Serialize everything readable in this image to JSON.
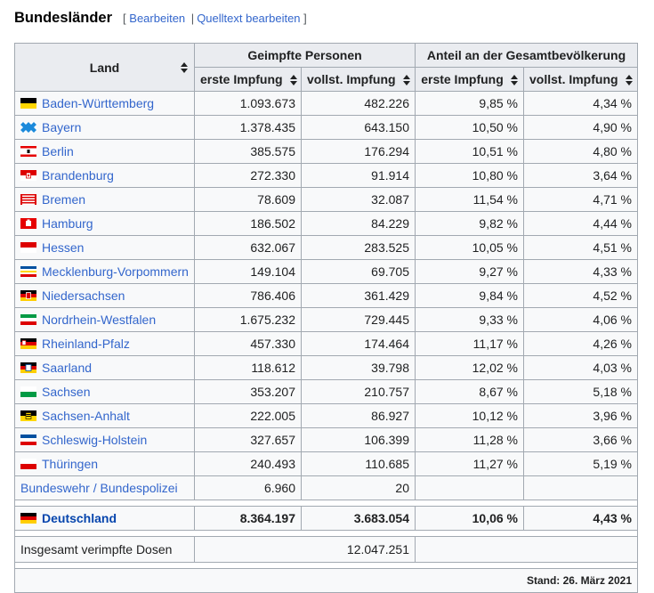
{
  "section": {
    "title": "Bundesländer",
    "bracket_open": "[",
    "edit": "Bearbeiten",
    "separator": "|",
    "edit_source": "Quelltext bearbeiten",
    "bracket_close": "]"
  },
  "table": {
    "header_land": "Land",
    "header_group1": "Geimpfte Personen",
    "header_group2": "Anteil an der Gesamtbevölkerung",
    "sub_erste": "erste Impfung",
    "sub_vollst": "vollst. Impfung",
    "rows": [
      {
        "name": "Baden-Württemberg",
        "flag": "bw",
        "erste": "1.093.673",
        "vollst": "482.226",
        "p_erste": "9,85 %",
        "p_vollst": "4,34 %"
      },
      {
        "name": "Bayern",
        "flag": "by",
        "erste": "1.378.435",
        "vollst": "643.150",
        "p_erste": "10,50 %",
        "p_vollst": "4,90 %"
      },
      {
        "name": "Berlin",
        "flag": "be",
        "erste": "385.575",
        "vollst": "176.294",
        "p_erste": "10,51 %",
        "p_vollst": "4,80 %"
      },
      {
        "name": "Brandenburg",
        "flag": "bb",
        "erste": "272.330",
        "vollst": "91.914",
        "p_erste": "10,80 %",
        "p_vollst": "3,64 %"
      },
      {
        "name": "Bremen",
        "flag": "hb",
        "erste": "78.609",
        "vollst": "32.087",
        "p_erste": "11,54 %",
        "p_vollst": "4,71 %"
      },
      {
        "name": "Hamburg",
        "flag": "hh",
        "erste": "186.502",
        "vollst": "84.229",
        "p_erste": "9,82 %",
        "p_vollst": "4,44 %"
      },
      {
        "name": "Hessen",
        "flag": "he",
        "erste": "632.067",
        "vollst": "283.525",
        "p_erste": "10,05 %",
        "p_vollst": "4,51 %"
      },
      {
        "name": "Mecklenburg-Vorpommern",
        "flag": "mv",
        "erste": "149.104",
        "vollst": "69.705",
        "p_erste": "9,27 %",
        "p_vollst": "4,33 %"
      },
      {
        "name": "Niedersachsen",
        "flag": "ni",
        "erste": "786.406",
        "vollst": "361.429",
        "p_erste": "9,84 %",
        "p_vollst": "4,52 %"
      },
      {
        "name": "Nordrhein-Westfalen",
        "flag": "nw",
        "erste": "1.675.232",
        "vollst": "729.445",
        "p_erste": "9,33 %",
        "p_vollst": "4,06 %"
      },
      {
        "name": "Rheinland-Pfalz",
        "flag": "rp",
        "erste": "457.330",
        "vollst": "174.464",
        "p_erste": "11,17 %",
        "p_vollst": "4,26 %"
      },
      {
        "name": "Saarland",
        "flag": "sl",
        "erste": "118.612",
        "vollst": "39.798",
        "p_erste": "12,02 %",
        "p_vollst": "4,03 %"
      },
      {
        "name": "Sachsen",
        "flag": "sn",
        "erste": "353.207",
        "vollst": "210.757",
        "p_erste": "8,67 %",
        "p_vollst": "5,18 %"
      },
      {
        "name": "Sachsen-Anhalt",
        "flag": "st",
        "erste": "222.005",
        "vollst": "86.927",
        "p_erste": "10,12 %",
        "p_vollst": "3,96 %"
      },
      {
        "name": "Schleswig-Holstein",
        "flag": "sh",
        "erste": "327.657",
        "vollst": "106.399",
        "p_erste": "11,28 %",
        "p_vollst": "3,66 %"
      },
      {
        "name": "Thüringen",
        "flag": "th",
        "erste": "240.493",
        "vollst": "110.685",
        "p_erste": "11,27 %",
        "p_vollst": "5,19 %"
      }
    ],
    "bundeswehr": {
      "name": "Bundeswehr / Bundespolizei",
      "erste": "6.960",
      "vollst": "20"
    },
    "total": {
      "name": "Deutschland",
      "flag": "de",
      "erste": "8.364.197",
      "vollst": "3.683.054",
      "p_erste": "10,06 %",
      "p_vollst": "4,43 %"
    },
    "doses": {
      "label": "Insgesamt verimpfte Dosen",
      "value": "12.047.251"
    },
    "stand": "Stand: 26. März 2021"
  },
  "colors": {
    "link": "#3366cc",
    "header_bg": "#eaecf0",
    "cell_bg": "#f8f9fa",
    "border": "#a2a9b1"
  }
}
